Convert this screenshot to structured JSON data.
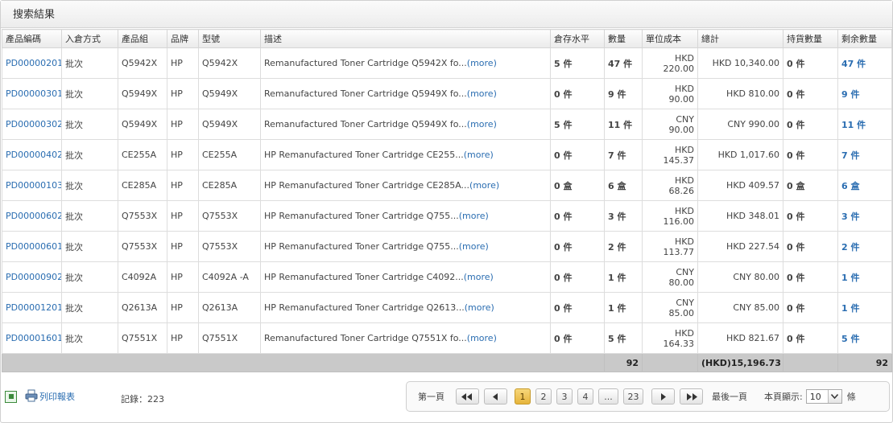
{
  "panel_title": "搜索結果",
  "columns": [
    "產品編碼",
    "入倉方式",
    "產品組",
    "品牌",
    "型號",
    "描述",
    "倉存水平",
    "數量",
    "單位成本",
    "總計",
    "持貨數量",
    "剩余數量"
  ],
  "more_label": "(more)",
  "rows": [
    {
      "code": "PD00000201",
      "method": "批次",
      "group": "Q5942X",
      "brand": "HP",
      "model": "Q5942X",
      "desc": "Remanufactured Toner Cartridge Q5942X fo...",
      "stock": "5 件",
      "qty": "47 件",
      "cost_cur": "HKD",
      "cost_val": "220.00",
      "total": "HKD 10,340.00",
      "held": "0 件",
      "remain": "47 件"
    },
    {
      "code": "PD00000301",
      "method": "批次",
      "group": "Q5949X",
      "brand": "HP",
      "model": "Q5949X",
      "desc": "Remanufactured Toner Cartridge Q5949X fo...",
      "stock": "0 件",
      "qty": "9 件",
      "cost_cur": "HKD",
      "cost_val": "90.00",
      "total": "HKD 810.00",
      "held": "0 件",
      "remain": "9 件"
    },
    {
      "code": "PD00000302",
      "method": "批次",
      "group": "Q5949X",
      "brand": "HP",
      "model": "Q5949X",
      "desc": "Remanufactured Toner Cartridge Q5949X fo...",
      "stock": "5 件",
      "qty": "11 件",
      "cost_cur": "CNY",
      "cost_val": "90.00",
      "total": "CNY 990.00",
      "held": "0 件",
      "remain": "11 件"
    },
    {
      "code": "PD00000402",
      "method": "批次",
      "group": "CE255A",
      "brand": "HP",
      "model": "CE255A",
      "desc": "HP Remanufactured Toner Cartridge CE255...",
      "stock": "0 件",
      "qty": "7 件",
      "cost_cur": "HKD",
      "cost_val": "145.37",
      "total": "HKD 1,017.60",
      "held": "0 件",
      "remain": "7 件"
    },
    {
      "code": "PD00000103",
      "method": "批次",
      "group": "CE285A",
      "brand": "HP",
      "model": "CE285A",
      "desc": "HP Remanufactured Toner Cartridge CE285A...",
      "stock": "0 盒",
      "qty": "6 盒",
      "cost_cur": "HKD",
      "cost_val": "68.26",
      "total": "HKD 409.57",
      "held": "0 盒",
      "remain": "6 盒"
    },
    {
      "code": "PD00000602",
      "method": "批次",
      "group": "Q7553X",
      "brand": "HP",
      "model": "Q7553X",
      "desc": "HP Remanufactured Toner Cartridge Q755...",
      "stock": "0 件",
      "qty": "3 件",
      "cost_cur": "HKD",
      "cost_val": "116.00",
      "total": "HKD 348.01",
      "held": "0 件",
      "remain": "3 件"
    },
    {
      "code": "PD00000601",
      "method": "批次",
      "group": "Q7553X",
      "brand": "HP",
      "model": "Q7553X",
      "desc": "HP Remanufactured Toner Cartridge Q755...",
      "stock": "0 件",
      "qty": "2 件",
      "cost_cur": "HKD",
      "cost_val": "113.77",
      "total": "HKD 227.54",
      "held": "0 件",
      "remain": "2 件"
    },
    {
      "code": "PD00000902",
      "method": "批次",
      "group": "C4092A",
      "brand": "HP",
      "model": "C4092A -A",
      "desc": "HP Remanufactured Toner Cartridge C4092...",
      "stock": "0 件",
      "qty": "1 件",
      "cost_cur": "CNY",
      "cost_val": "80.00",
      "total": "CNY 80.00",
      "held": "0 件",
      "remain": "1 件"
    },
    {
      "code": "PD00001201",
      "method": "批次",
      "group": "Q2613A",
      "brand": "HP",
      "model": "Q2613A",
      "desc": "HP Remanufactured Toner Cartridge Q2613...",
      "stock": "0 件",
      "qty": "1 件",
      "cost_cur": "CNY",
      "cost_val": "85.00",
      "total": "CNY 85.00",
      "held": "0 件",
      "remain": "1 件"
    },
    {
      "code": "PD00001601",
      "method": "批次",
      "group": "Q7551X",
      "brand": "HP",
      "model": "Q7551X",
      "desc": "Remanufactured Toner Cartridge Q7551X fo...",
      "stock": "0 件",
      "qty": "5 件",
      "cost_cur": "HKD",
      "cost_val": "164.33",
      "total": "HKD 821.67",
      "held": "0 件",
      "remain": "5 件"
    }
  ],
  "footer": {
    "qty_total": "92",
    "grand_total": "(HKD)15,196.73",
    "remain_total": "92"
  },
  "tools": {
    "print_label": "列印報表"
  },
  "records_label": "記錄：223",
  "pager": {
    "first_label": "第一頁",
    "last_label": "最後一頁",
    "pages": [
      "1",
      "2",
      "3",
      "4",
      "...",
      "23"
    ],
    "active_page": "1",
    "per_page_label": "本頁顯示:",
    "per_page_value": "10",
    "per_page_suffix": "條"
  },
  "colors": {
    "link": "#2a6db1",
    "active_page": "#e6b43b",
    "footer_bg": "#c9c9c9"
  }
}
